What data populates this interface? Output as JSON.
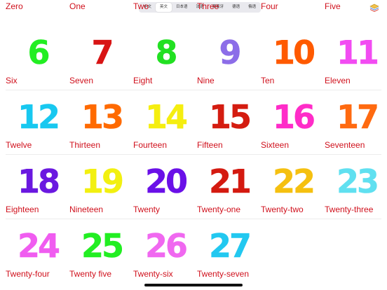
{
  "lang_tabs": [
    "中文",
    "英文",
    "日本语",
    "法语",
    "葡萄牙",
    "德语",
    "俄语"
  ],
  "active_lang_index": 1,
  "toolbar_icon": "layers-icon",
  "label_color": "#d0101c",
  "cells": [
    {
      "number": "",
      "word": "Zero",
      "color": "#ff2020"
    },
    {
      "number": "",
      "word": "One",
      "color": "#ff7a00"
    },
    {
      "number": "",
      "word": "Two",
      "color": "#ffd400"
    },
    {
      "number": "",
      "word": "Three",
      "color": "#2aff2a"
    },
    {
      "number": "",
      "word": "Four",
      "color": "#ff8800"
    },
    {
      "number": "",
      "word": "Five",
      "color": "#ff40ff"
    },
    {
      "number": "6",
      "word": "Six",
      "color": "#22ee22"
    },
    {
      "number": "7",
      "word": "Seven",
      "color": "#d81414"
    },
    {
      "number": "8",
      "word": "Eight",
      "color": "#22e022"
    },
    {
      "number": "9",
      "word": "Nine",
      "color": "#8c6de8"
    },
    {
      "number": "10",
      "word": "Ten",
      "color": "#ff5a00"
    },
    {
      "number": "11",
      "word": "Eleven",
      "color": "#f24cf2"
    },
    {
      "number": "12",
      "word": "Twelve",
      "color": "#18c8f0"
    },
    {
      "number": "13",
      "word": "Thirteen",
      "color": "#ff6a00"
    },
    {
      "number": "14",
      "word": "Fourteen",
      "color": "#f5ee10"
    },
    {
      "number": "15",
      "word": "Fifteen",
      "color": "#d41c10"
    },
    {
      "number": "16",
      "word": "Sixteen",
      "color": "#ff2cc8"
    },
    {
      "number": "17",
      "word": "Seventeen",
      "color": "#ff6a10"
    },
    {
      "number": "18",
      "word": "Eighteen",
      "color": "#6a18e0"
    },
    {
      "number": "19",
      "word": "Nineteen",
      "color": "#f2f010"
    },
    {
      "number": "20",
      "word": "Twenty",
      "color": "#6a10e8"
    },
    {
      "number": "21",
      "word": "Twenty-one",
      "color": "#d41a10"
    },
    {
      "number": "22",
      "word": "Twenty-two",
      "color": "#f5c010"
    },
    {
      "number": "23",
      "word": "Twenty-three",
      "color": "#60e0f0"
    },
    {
      "number": "24",
      "word": "Twenty-four",
      "color": "#f05cf0"
    },
    {
      "number": "25",
      "word": "Twenty five",
      "color": "#22ee22"
    },
    {
      "number": "26",
      "word": "Twenty-six",
      "color": "#f068f0"
    },
    {
      "number": "27",
      "word": "Twenty-seven",
      "color": "#22c8f0"
    }
  ]
}
